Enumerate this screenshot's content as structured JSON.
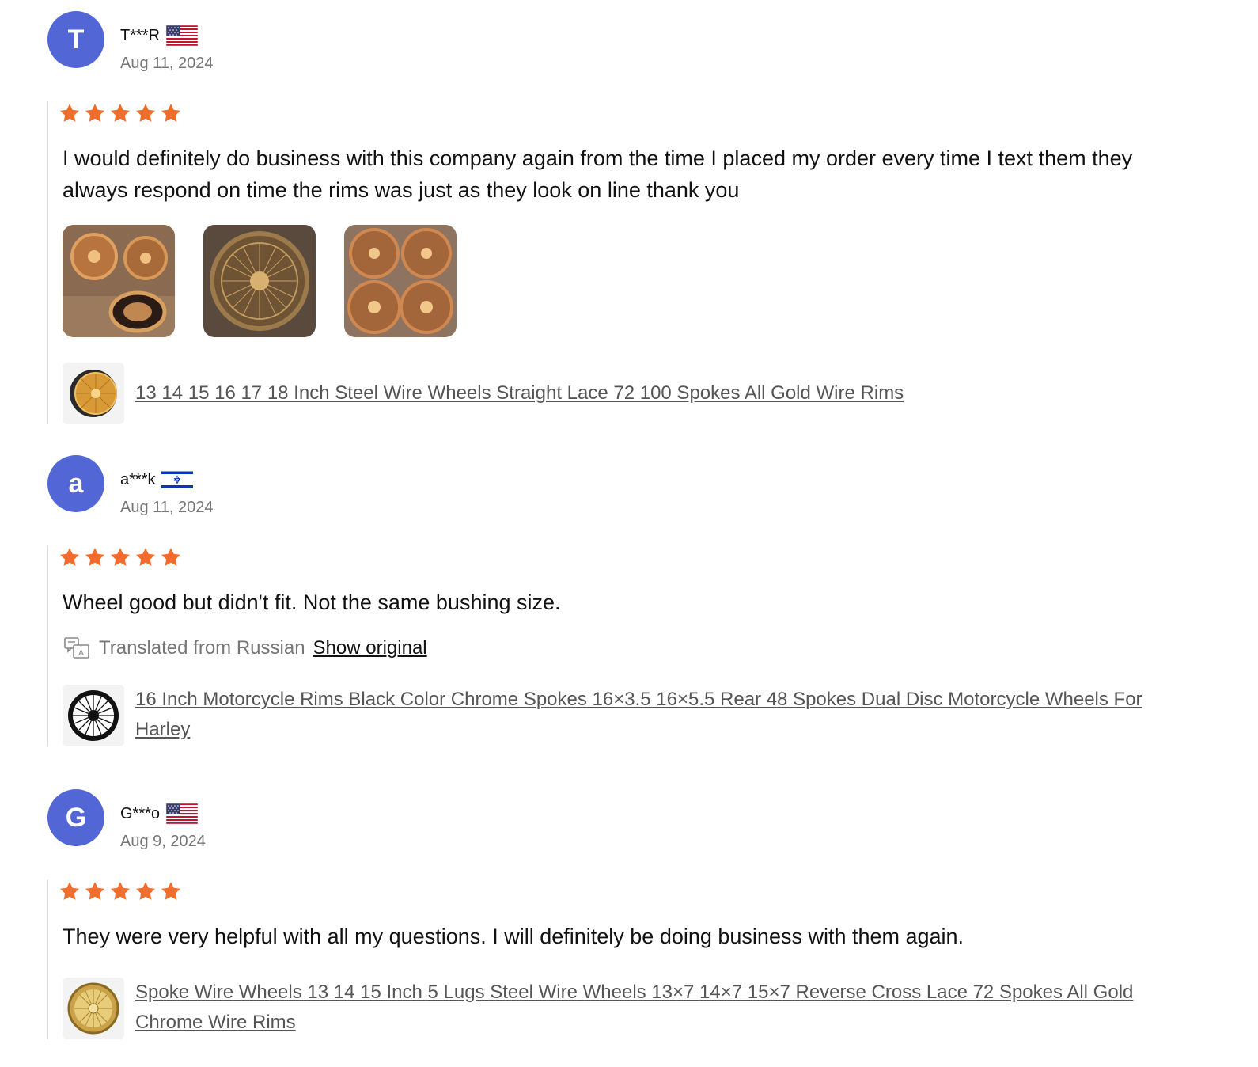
{
  "reviews": [
    {
      "avatar_letter": "T",
      "user": "T***R",
      "flag": "us-flag-icon",
      "date": "Aug 11, 2024",
      "rating": 5,
      "text": "I would definitely do business with this company again from the time I placed my order every time I text them they always respond on time the rims was just as they look on line thank you",
      "photos": [
        "gold-wire-wheels-photo",
        "gold-wire-wheel-closeup-photo",
        "four-gold-wheels-photo"
      ],
      "product": {
        "title": "13 14 15 16 17 18 Inch Steel Wire Wheels Straight Lace 72 100 Spokes All Gold Wire Rims",
        "thumb_icon": "gold-wire-wheel-thumbnail"
      }
    },
    {
      "avatar_letter": "a",
      "user": "a***k",
      "flag": "il-flag-icon",
      "date": "Aug 11, 2024",
      "rating": 5,
      "text": "Wheel good but didn't fit. Not the same bushing size.",
      "translation": {
        "note": "Translated from Russian",
        "show_original": "Show original"
      },
      "product": {
        "title": "16 Inch Motorcycle Rims Black Color Chrome Spokes 16×3.5 16×5.5 Rear 48 Spokes Dual Disc Motorcycle Wheels For Harley",
        "thumb_icon": "black-motorcycle-wheel-thumbnail"
      }
    },
    {
      "avatar_letter": "G",
      "user": "G***o",
      "flag": "us-flag-icon",
      "date": "Aug 9, 2024",
      "rating": 5,
      "text": "They were very helpful with all my questions. I will definitely be doing business with them again.",
      "product": {
        "title": "Spoke Wire Wheels 13 14 15 Inch 5 Lugs Steel Wire Wheels 13×7 14×7 15×7 Reverse Cross Lace 72 Spokes All Gold Chrome Wire Rims",
        "thumb_icon": "gold-chrome-wire-wheel-thumbnail"
      }
    }
  ],
  "colors": {
    "avatar_bg": "#5266d6",
    "star": "#f26c2b",
    "muted_text": "#767676",
    "link_text": "#555555"
  }
}
